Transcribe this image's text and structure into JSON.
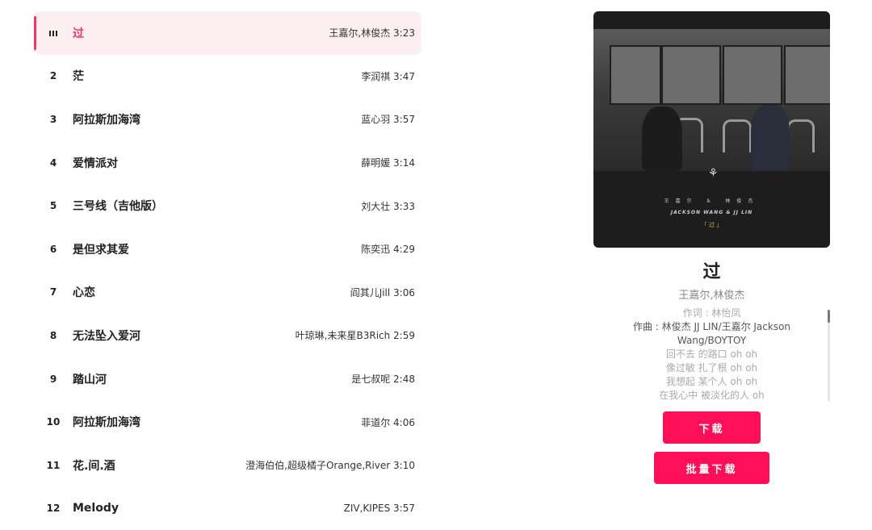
{
  "playlist": [
    {
      "num": "",
      "title": "过",
      "meta": "王嘉尔,林俊杰 3:23",
      "playing": true
    },
    {
      "num": "2",
      "title": "茫",
      "meta": "李润祺 3:47"
    },
    {
      "num": "3",
      "title": "阿拉斯加海湾",
      "meta": "蓝心羽 3:57"
    },
    {
      "num": "4",
      "title": "爱情派对",
      "meta": "薛明媛 3:14"
    },
    {
      "num": "5",
      "title": "三号线（吉他版）",
      "meta": "刘大壮 3:33"
    },
    {
      "num": "6",
      "title": "是但求其爱",
      "meta": "陈奕迅 4:29"
    },
    {
      "num": "7",
      "title": "心恋",
      "meta": "阎其儿Jill 3:06"
    },
    {
      "num": "8",
      "title": "无法坠入爱河",
      "meta": "叶琼琳,未来星B3Rich 2:59"
    },
    {
      "num": "9",
      "title": "踏山河",
      "meta": "是七叔呢 2:48"
    },
    {
      "num": "10",
      "title": "阿拉斯加海湾",
      "meta": "菲道尔 4:06"
    },
    {
      "num": "11",
      "title": "花.间.酒",
      "meta": "澄海伯伯,超级橘子Orange,River 3:10"
    },
    {
      "num": "12",
      "title": "Melody",
      "meta": "ZIV,KIPES 3:57"
    }
  ],
  "now_playing": {
    "cover": {
      "cn_names": "王嘉尔  ＆  林俊杰",
      "artist_line": "JACKSON WANG & JJ LIN",
      "bracket": "「 过 」"
    },
    "title": "过",
    "artist": "王嘉尔,林俊杰",
    "lyrics": [
      "作词 : 林怡凤",
      "作曲 : 林俊杰 JJ LIN/王嘉尔 Jackson Wang/BOYTOY",
      "回不去 的路口 oh oh",
      "像过敏 扎了根 oh oh",
      "我想起 某个人 oh oh",
      "在我心中 被淡化的人 oh"
    ],
    "download_label": "下载",
    "batch_download_label": "批量下载"
  },
  "colors": {
    "accent": "#ff0f57",
    "active_bg": "#fdeef2",
    "active_text": "#f0365e"
  }
}
